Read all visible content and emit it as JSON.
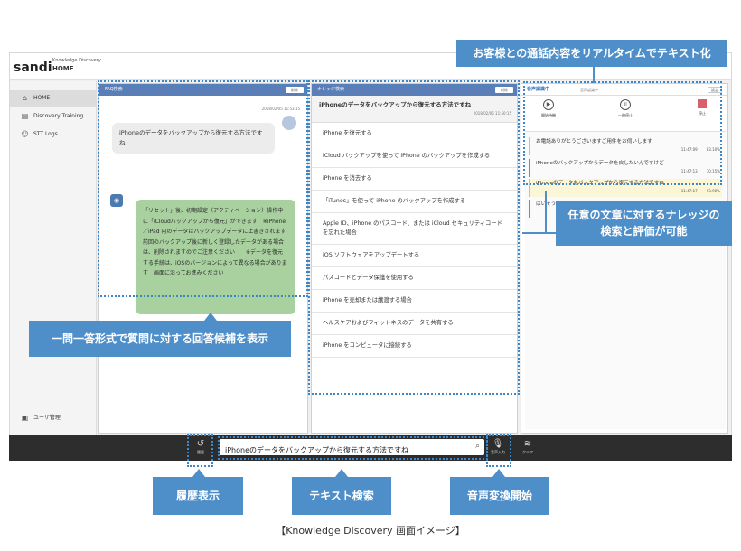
{
  "header": {
    "logo": "sandi",
    "brand_sub": "Knowledge Discovery",
    "page": "HOME"
  },
  "sidebar": {
    "items": [
      {
        "label": "HOME",
        "icon": "home-icon"
      },
      {
        "label": "Discovery Training",
        "icon": "book-icon"
      },
      {
        "label": "STT Logs",
        "icon": "users-icon"
      }
    ],
    "footer_label": "ユーザ管理"
  },
  "faq": {
    "title": "FAQ検索",
    "reset": "削除",
    "timestamp": "2018/02/05 11:53:15",
    "question": "iPhoneのデータをバックアップから復元する方法ですね",
    "answer": "「リセット」後、初期設定（アクティベーション）操作中に「iCloudバックアップから復元」ができます　※iPhone／iPad 内のデータはバックアップデータに上書きされます　　前回のバックアップ後に新しく登録したデータがある場合は、削除されますのでご注意ください　　※データを復元する手続は、iOSのバージョンによって異なる場合があります　画面に沿ってお進みください"
  },
  "knowledge": {
    "title": "ナレッジ検索",
    "reset": "削除",
    "query": "iPhoneのデータをバックアップから復元する方法ですね",
    "timestamp": "2018/02/05 11:50:15",
    "results": [
      "iPhone を復元する",
      "iCloud バックアップを使って iPhone のバックアップを作成する",
      "iPhone を消去する",
      "「iTunes」を使って iPhone のバックアップを作成する",
      "Apple ID、iPhone のパスコード、または iCloud セキュリティコードを忘れた場合",
      "iOS ソフトウェアをアップデートする",
      "パスコードとデータ保護を使用する",
      "iPhone を売却または譲渡する場合",
      "ヘルスケアおよびフィットネスのデータを共有する",
      "iPhone をコンピュータに接続する"
    ]
  },
  "voice": {
    "title": "音声認識中",
    "status": "音声認識中",
    "settings": "設定",
    "controls": [
      {
        "label": "開始待機",
        "icon": "play-icon"
      },
      {
        "label": "一時停止",
        "icon": "pause-icon"
      },
      {
        "label": "停止",
        "icon": "stop-icon"
      }
    ],
    "log": [
      {
        "text": "お電話ありがとうございますご用件をお伺いします",
        "time": "11:47:09",
        "score": "83.10%"
      },
      {
        "text": "iPhoneのバックアップからデータを戻したいんですけど",
        "time": "11:47:13",
        "score": "70.15%"
      },
      {
        "text": "iPhoneのデータをバックアップから復元する方法ですね",
        "time": "11:47:17",
        "score": "93.90%"
      },
      {
        "text": "はいそうです",
        "time": "",
        "score": ""
      }
    ]
  },
  "bottom": {
    "history_label": "履歴",
    "search_value": "iPhoneのデータをバックアップから復元する方法ですね",
    "voice_label": "音声入力",
    "clear_label": "クリア"
  },
  "callouts": {
    "realtime": "お客様との通話内容をリアルタイムでテキスト化",
    "knowledge_eval": "任意の文章に対するナレッジの\n検索と評価が可能",
    "faq": "一問一答形式で質問に対する回答候補を表示",
    "history": "履歴表示",
    "text_search": "テキスト検索",
    "voice_start": "音声変換開始"
  },
  "caption": "【Knowledge Discovery 画面イメージ】",
  "colors": {
    "accent": "#4f8fc9",
    "panel_header": "#5a7fb8",
    "bot_bubble": "#a9d1a0",
    "bottom_bar": "#2d2d2d"
  }
}
